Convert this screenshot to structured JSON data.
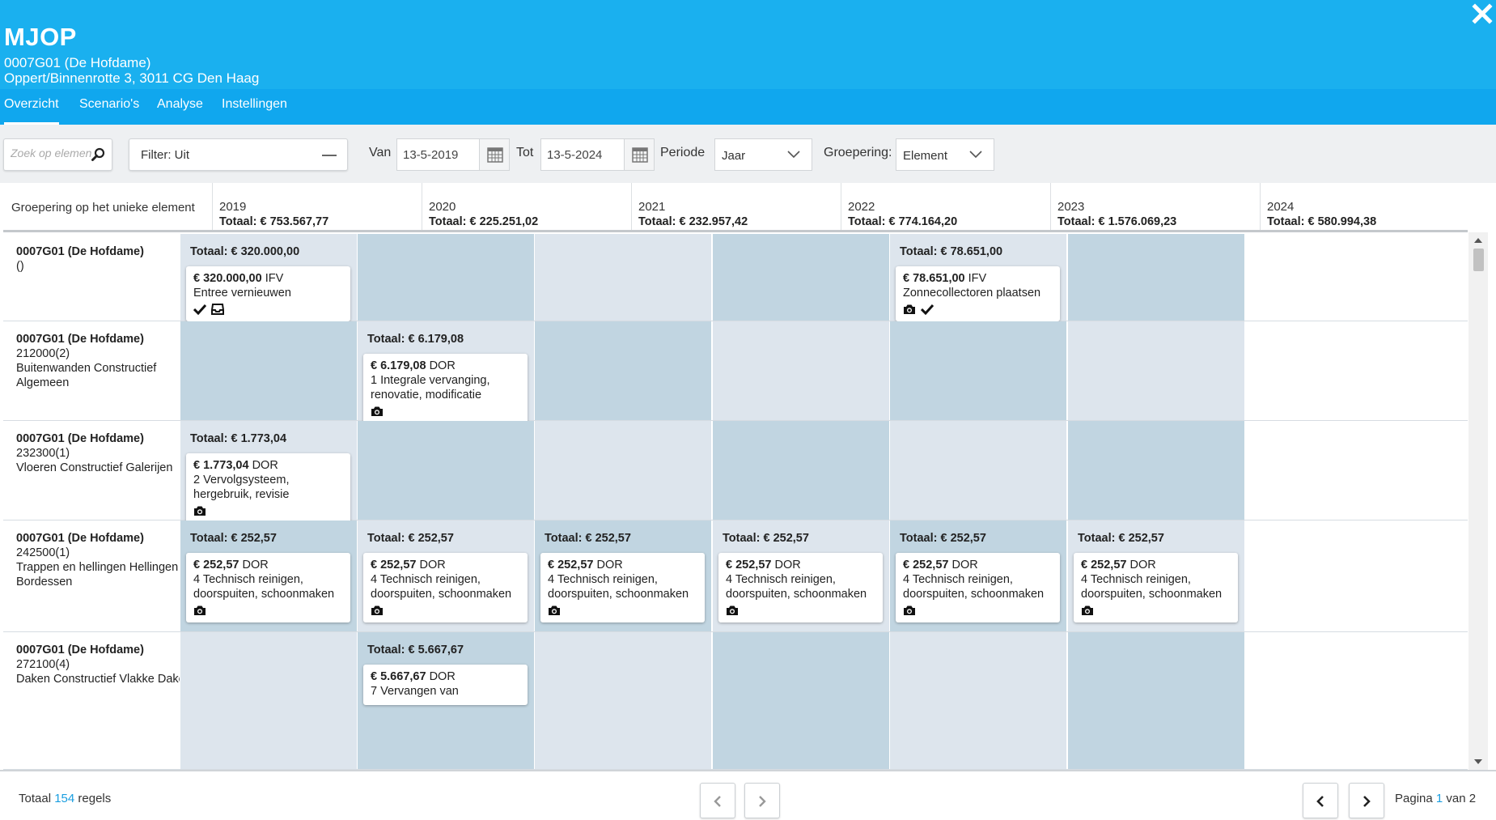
{
  "header": {
    "title": "MJOP",
    "subtitle_line1": "0007G01 (De Hofdame)",
    "subtitle_line2": "Oppert/Binnenrotte 3, 3011 CG Den Haag"
  },
  "tabs": [
    {
      "label": "Overzicht",
      "active": true
    },
    {
      "label": "Scenario's",
      "active": false
    },
    {
      "label": "Analyse",
      "active": false
    },
    {
      "label": "Instellingen",
      "active": false
    }
  ],
  "toolbar": {
    "search_placeholder": "Zoek op element",
    "filter_label": "Filter: Uit",
    "van_label": "Van",
    "van_value": "13-5-2019",
    "tot_label": "Tot",
    "tot_value": "13-5-2024",
    "periode_label": "Periode",
    "periode_value": "Jaar",
    "groepering_label": "Groepering:",
    "groepering_value": "Element"
  },
  "grid": {
    "group_label": "Groepering op het unieke element",
    "years": [
      {
        "year": "2019",
        "total": "Totaal: € 753.567,77"
      },
      {
        "year": "2020",
        "total": "Totaal: € 225.251,02"
      },
      {
        "year": "2021",
        "total": "Totaal: € 232.957,42"
      },
      {
        "year": "2022",
        "total": "Totaal: € 774.164,20"
      },
      {
        "year": "2023",
        "total": "Totaal: € 1.576.069,23"
      },
      {
        "year": "2024",
        "total": "Totaal: € 580.994,38"
      }
    ],
    "rows": [
      {
        "title": "0007G01 (De Hofdame)",
        "lines": [
          "()"
        ],
        "cells": [
          {
            "total": "Totaal: € 320.000,00",
            "amount": "€ 320.000,00",
            "code": "IFV",
            "desc": "Entree vernieuwen",
            "icons": [
              "check-icon",
              "inbox-icon"
            ]
          },
          null,
          null,
          null,
          {
            "total": "Totaal: € 78.651,00",
            "amount": "€ 78.651,00",
            "code": "IFV",
            "desc": "Zonnecollectoren plaatsen",
            "icons": [
              "camera-icon",
              "check-icon"
            ]
          },
          null
        ]
      },
      {
        "title": "0007G01 (De Hofdame)",
        "lines": [
          "212000(2)",
          "Buitenwanden Constructief Algemeen"
        ],
        "cells": [
          null,
          {
            "total": "Totaal: € 6.179,08",
            "amount": "€ 6.179,08",
            "code": "DOR",
            "desc": "1 Integrale vervanging, renovatie, modificatie",
            "icons": [
              "camera-icon"
            ]
          },
          null,
          null,
          null,
          null
        ]
      },
      {
        "title": "0007G01 (De Hofdame)",
        "lines": [
          "232300(1)",
          "Vloeren Constructief Galerijen"
        ],
        "cells": [
          {
            "total": "Totaal: € 1.773,04",
            "amount": "€ 1.773,04",
            "code": "DOR",
            "desc": "2 Vervolgsysteem, hergebruik, revisie",
            "icons": [
              "camera-icon"
            ]
          },
          null,
          null,
          null,
          null,
          null
        ]
      },
      {
        "title": "0007G01 (De Hofdame)",
        "lines": [
          "242500(1)",
          "Trappen en hellingen Hellingen Bordessen"
        ],
        "cells": [
          {
            "total": "Totaal: € 252,57",
            "amount": "€ 252,57",
            "code": "DOR",
            "desc": "4 Technisch reinigen, doorspuiten, schoonmaken",
            "icons": [
              "camera-icon"
            ]
          },
          {
            "total": "Totaal: € 252,57",
            "amount": "€ 252,57",
            "code": "DOR",
            "desc": "4 Technisch reinigen, doorspuiten, schoonmaken",
            "icons": [
              "camera-icon"
            ]
          },
          {
            "total": "Totaal: € 252,57",
            "amount": "€ 252,57",
            "code": "DOR",
            "desc": "4 Technisch reinigen, doorspuiten, schoonmaken",
            "icons": [
              "camera-icon"
            ]
          },
          {
            "total": "Totaal: € 252,57",
            "amount": "€ 252,57",
            "code": "DOR",
            "desc": "4 Technisch reinigen, doorspuiten, schoonmaken",
            "icons": [
              "camera-icon"
            ]
          },
          {
            "total": "Totaal: € 252,57",
            "amount": "€ 252,57",
            "code": "DOR",
            "desc": "4 Technisch reinigen, doorspuiten, schoonmaken",
            "icons": [
              "camera-icon"
            ]
          },
          {
            "total": "Totaal: € 252,57",
            "amount": "€ 252,57",
            "code": "DOR",
            "desc": "4 Technisch reinigen, doorspuiten, schoonmaken",
            "icons": [
              "camera-icon"
            ]
          }
        ]
      },
      {
        "title": "0007G01 (De Hofdame)",
        "lines": [
          "272100(4)",
          "Daken Constructief Vlakke Daken"
        ],
        "cells": [
          null,
          {
            "total": "Totaal: € 5.667,67",
            "amount": "€ 5.667,67",
            "code": "DOR",
            "desc": "7 Vervangen van",
            "icons": []
          },
          null,
          null,
          null,
          null
        ]
      }
    ]
  },
  "footer": {
    "total_prefix": "Totaal ",
    "total_count": "154",
    "total_suffix": " regels",
    "page_prefix": "Pagina ",
    "page_current": "1",
    "page_suffix": " van 2"
  },
  "colors": {
    "header_bg": "#1ab0ef",
    "tabs_bg": "#10a7ee",
    "cell_light": "#dde5ed",
    "cell_dark": "#c1d5e1",
    "link": "#1a9ee0"
  }
}
